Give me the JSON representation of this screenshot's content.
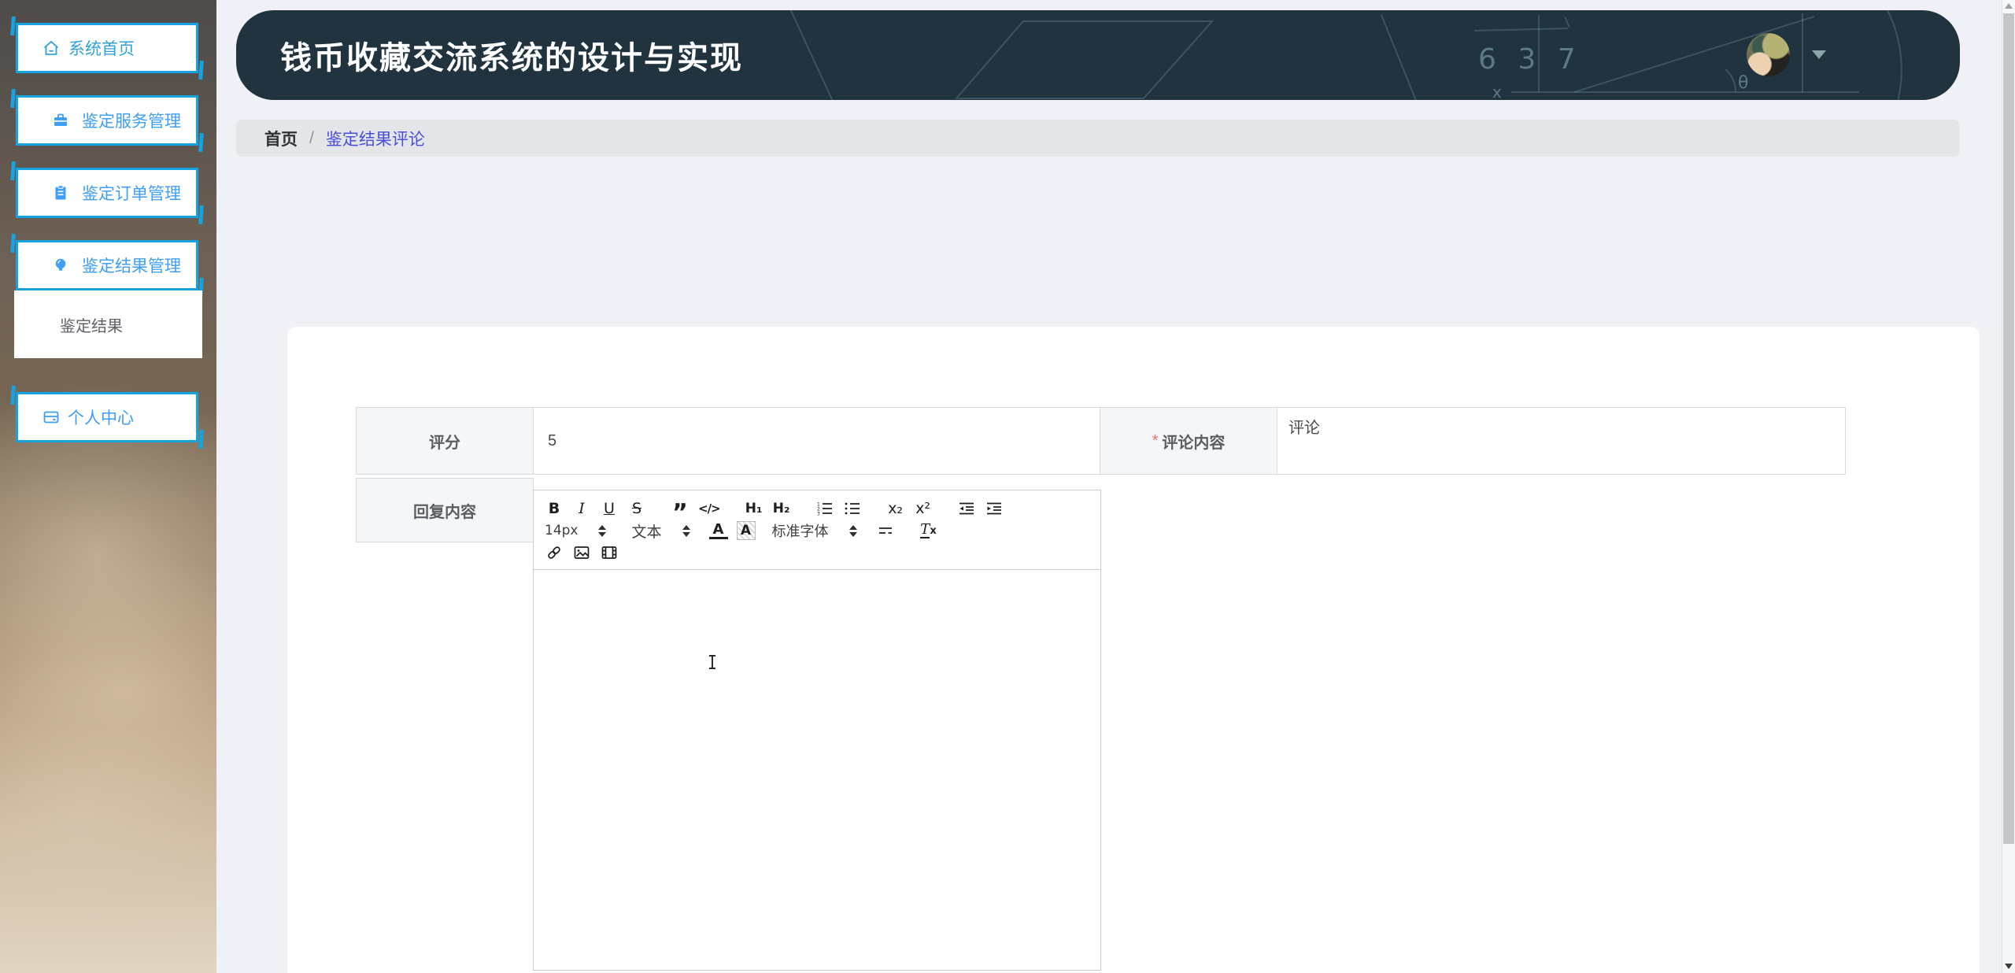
{
  "header": {
    "title": "钱币收藏交流系统的设计与实现",
    "sketch": {
      "number": "6 3 7",
      "theta": "θ",
      "x_label": "x"
    }
  },
  "sidebar": {
    "items": [
      {
        "label": "系统首页"
      },
      {
        "label": "鉴定服务管理"
      },
      {
        "label": "鉴定订单管理"
      },
      {
        "label": "鉴定结果管理"
      },
      {
        "label": "个人中心"
      }
    ],
    "submenu": {
      "label": "鉴定结果"
    }
  },
  "breadcrumb": {
    "home": "首页",
    "separator": "/",
    "current": "鉴定结果评论"
  },
  "form": {
    "score": {
      "label": "评分",
      "value": "5"
    },
    "comment": {
      "label": "评论内容",
      "required_mark": "*",
      "value": "评论"
    },
    "reply": {
      "label": "回复内容"
    }
  },
  "editor": {
    "buttons": {
      "bold": "B",
      "italic": "I",
      "underline": "U",
      "strike": "S",
      "blockquote": "”",
      "code": "</>",
      "h1": "H₁",
      "h2": "H₂",
      "subscript": "x₂",
      "superscript": "x²",
      "color_label": "A",
      "bg_label": "A",
      "clear_t": "T",
      "clear_x": "x"
    },
    "font_size": "14px",
    "format": "文本",
    "font_family": "标准字体"
  },
  "colors": {
    "accent_cyan": "#16a3df",
    "menu_blue": "#3f9ef5",
    "header_bg": "#20333e",
    "breadcrumb_link": "#4a4fd9",
    "required": "#f56c6c"
  }
}
